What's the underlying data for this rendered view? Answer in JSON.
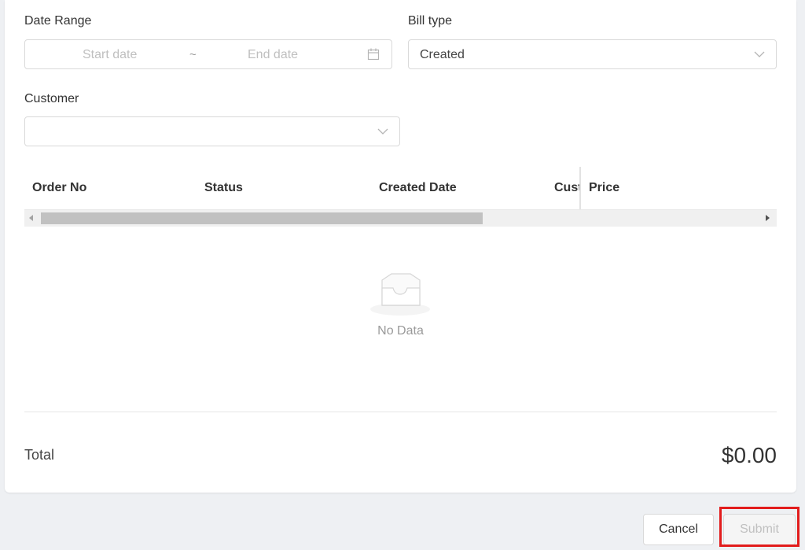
{
  "filters": {
    "date_range_label": "Date Range",
    "start_date_placeholder": "Start date",
    "range_separator": "~",
    "end_date_placeholder": "End date",
    "bill_type_label": "Bill type",
    "bill_type_value": "Created",
    "customer_label": "Customer",
    "customer_value": ""
  },
  "table": {
    "columns": [
      "Order No",
      "Status",
      "Created Date",
      "Cust",
      "Price"
    ],
    "empty_text": "No Data"
  },
  "summary": {
    "total_label": "Total",
    "total_value": "$0.00"
  },
  "footer": {
    "cancel_label": "Cancel",
    "submit_label": "Submit"
  },
  "colors": {
    "highlight": "#e21c1c",
    "page_background": "#eef0f3"
  },
  "icons": {
    "calendar": "calendar-icon",
    "dropdown": "chevron-down-icon",
    "empty": "empty-inbox-icon"
  }
}
